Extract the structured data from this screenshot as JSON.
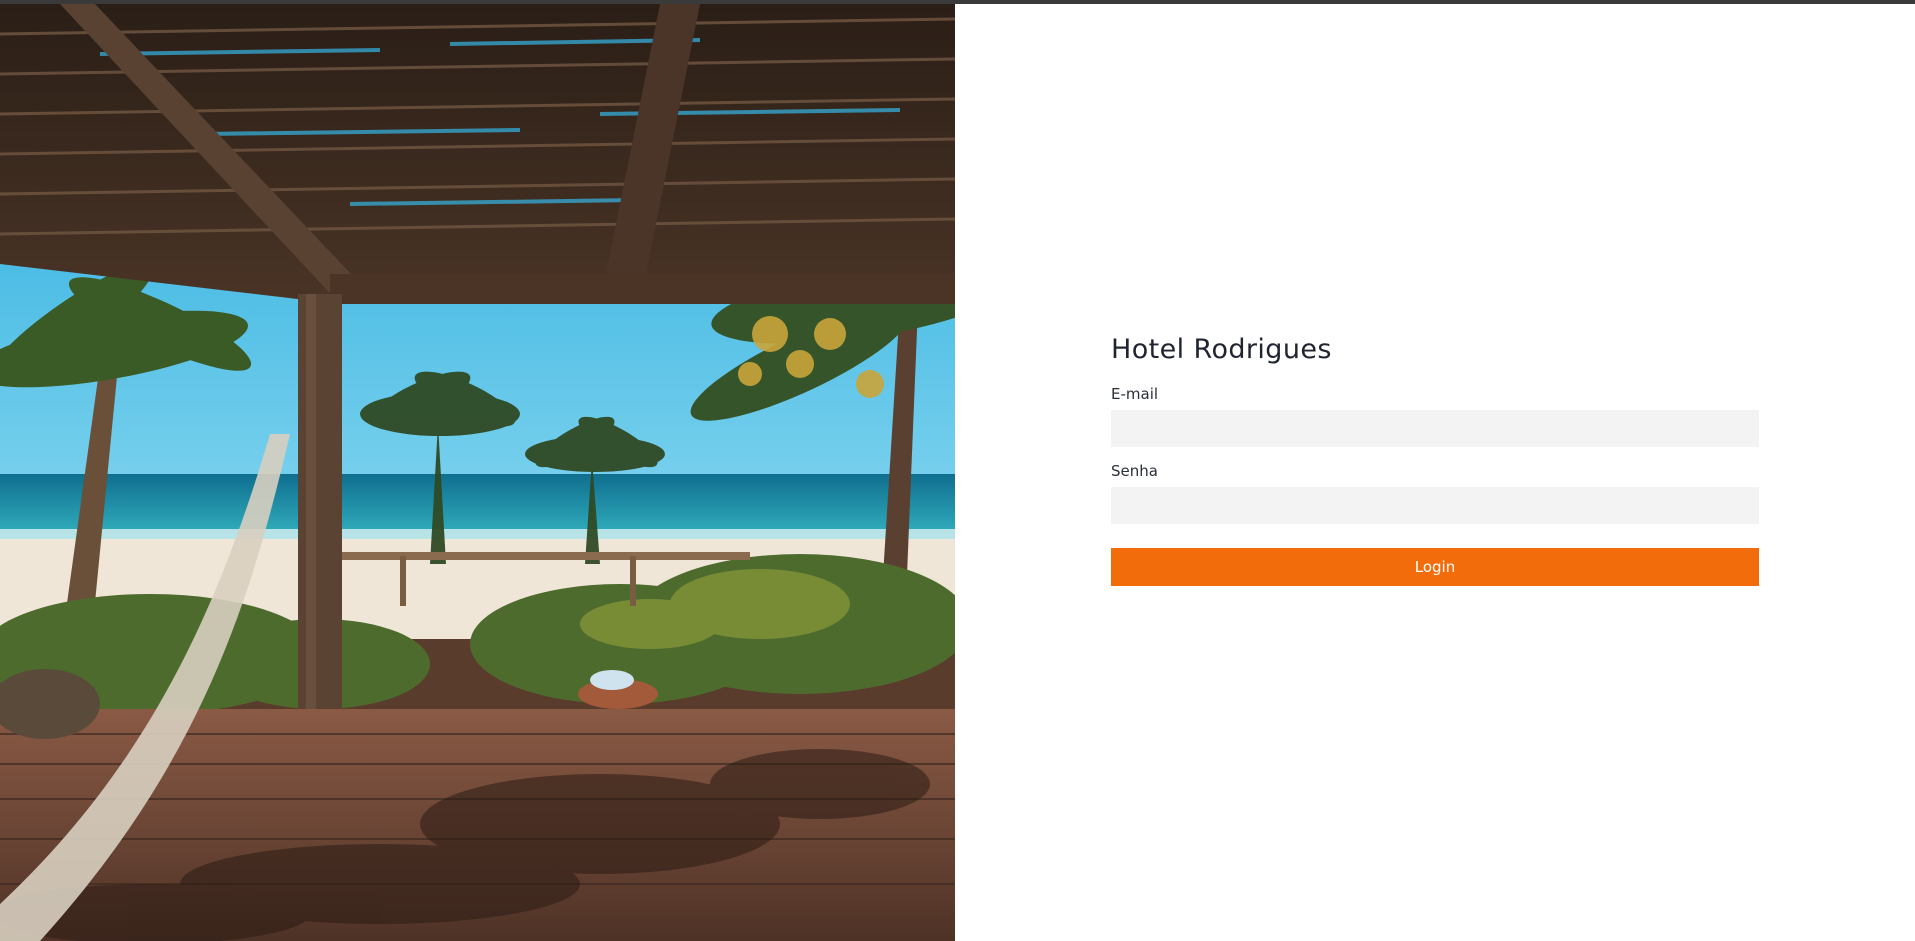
{
  "hero": {
    "image_name": "tropical-beach-deck-photo",
    "colors": {
      "sky": "#2fb6e3",
      "sea": "#1e8fa8",
      "sand": "#efe6d7",
      "roof": "#3b2a1f",
      "deck": "#7a4e3b",
      "foliage": "#3f5c2a"
    }
  },
  "login": {
    "title": "Hotel Rodrigues",
    "email_label": "E-mail",
    "email_value": "",
    "password_label": "Senha",
    "password_value": "",
    "submit_label": "Login"
  },
  "colors": {
    "accent": "#f36c0b",
    "input_bg": "#f3f3f3",
    "text": "#1f2430"
  }
}
